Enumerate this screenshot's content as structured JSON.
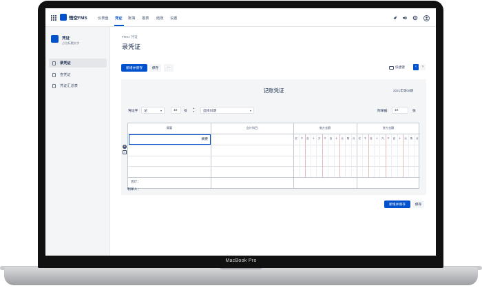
{
  "device": {
    "label": "MacBook Pro"
  },
  "app": {
    "name": "悟空FMS"
  },
  "topnav": {
    "items": [
      {
        "label": "仪表盘"
      },
      {
        "label": "凭证"
      },
      {
        "label": "账簿"
      },
      {
        "label": "报表"
      },
      {
        "label": "结账"
      },
      {
        "label": "设置"
      }
    ],
    "active_index": 1,
    "icons": [
      "rocket-icon",
      "speaker-icon",
      "gear-icon",
      "user-avatar-icon"
    ]
  },
  "sidebar": {
    "title": "凭证",
    "subtitle": "占位标题文字",
    "items": [
      {
        "label": "录凭证",
        "active": true
      },
      {
        "label": "查凭证",
        "active": false
      },
      {
        "label": "凭证汇总表",
        "active": false
      }
    ]
  },
  "main": {
    "breadcrumb": "FMS / 凭证",
    "title": "录凭证",
    "toolbar": {
      "save_new_label": "新增并保存",
      "save_label": "保存",
      "more_label": "···",
      "quick_key_label": "快捷键"
    }
  },
  "voucher": {
    "title": "记账凭证",
    "period": "2021年第09期",
    "type_label": "凭证字",
    "type_value": "记",
    "number_value": "10",
    "number_suffix": "号",
    "date_placeholder": "选择日期",
    "attachments_label": "附单据",
    "attachments_value": "10",
    "attachments_suffix": "张",
    "columns": {
      "summary": "摘要",
      "account": "会计科目",
      "debit": "借方金额",
      "credit": "贷方金额"
    },
    "digit_units": [
      "亿",
      "千",
      "百",
      "十",
      "万",
      "千",
      "百",
      "十",
      "元",
      "角",
      "分"
    ],
    "active_cell_text": "摘要",
    "total_label": "合计：",
    "maker_label": "制单人："
  },
  "footer": {
    "save_new_label": "新增并保存",
    "save_label": "保存"
  },
  "colors": {
    "accent": "#0052cc",
    "background": "#f4f5f7",
    "text": "#172b4d"
  }
}
